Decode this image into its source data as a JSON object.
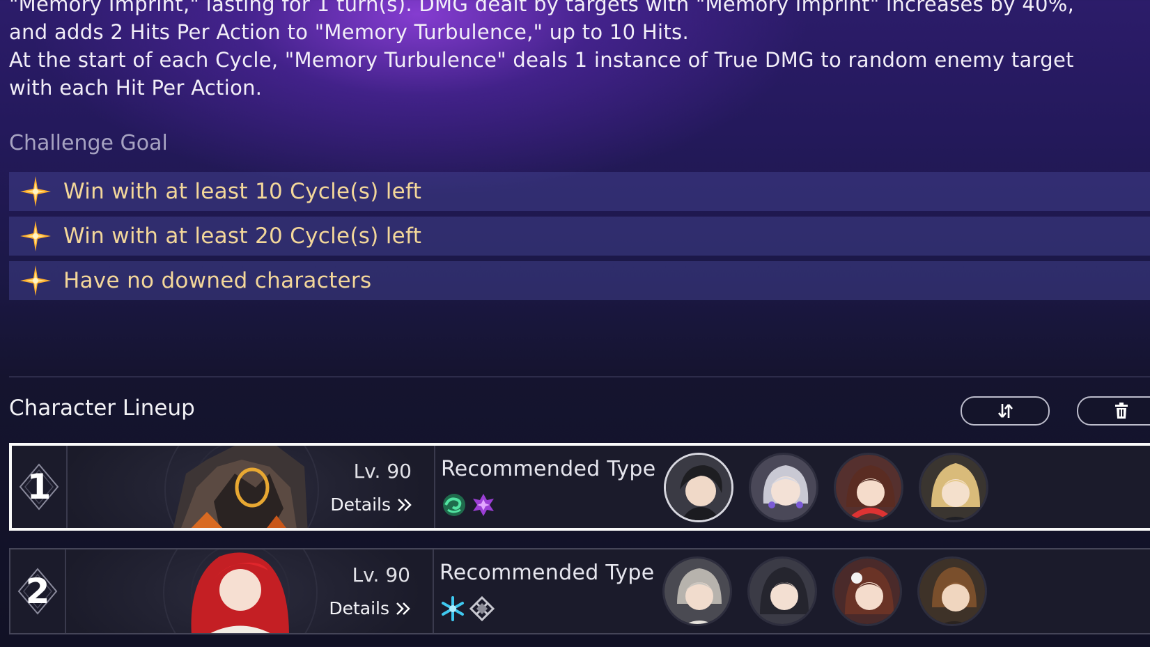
{
  "description": {
    "line1": "\"Memory Imprint,\" lasting for 1 turn(s). DMG dealt by targets with \"Memory Imprint\" increases by 40%,",
    "line2": "and adds 2 Hits Per Action to \"Memory Turbulence,\" up to 10 Hits.",
    "line3": "At the start of each Cycle, \"Memory Turbulence\" deals 1 instance of True DMG to random enemy target",
    "line4": "with each Hit Per Action."
  },
  "challenge_goal": {
    "title": "Challenge Goal",
    "items": [
      {
        "text": "Win with at least 10 Cycle(s) left",
        "icon": "star-burst-icon"
      },
      {
        "text": "Win with at least 20 Cycle(s) left",
        "icon": "star-burst-icon"
      },
      {
        "text": "Have no downed characters",
        "icon": "star-burst-icon"
      }
    ]
  },
  "lineup": {
    "title": "Character Lineup",
    "swap_icon": "swap-icon",
    "delete_icon": "trash-icon",
    "teams": [
      {
        "number": "1",
        "level": "Lv. 90",
        "details_label": "Details",
        "recommended_label": "Recommended Type",
        "types": [
          "wind-element-icon",
          "imaginary-element-icon"
        ],
        "avatars": [
          "avatar-dark-hair-male",
          "avatar-silver-hair-female",
          "avatar-brown-hair-female",
          "avatar-blonde-hair-male"
        ],
        "selected": true
      },
      {
        "number": "2",
        "level": "Lv. 90",
        "details_label": "Details",
        "recommended_label": "Recommended Type",
        "types": [
          "ice-element-icon",
          "physical-element-icon"
        ],
        "avatars": [
          "avatar-grey-hair-male",
          "avatar-black-hair-female",
          "avatar-auburn-hair-female",
          "avatar-brown-hair-male"
        ],
        "selected": false
      }
    ]
  },
  "colors": {
    "goal_text": "#f3d79a",
    "star": "#ffb02e",
    "selected_border": "#fafafa"
  }
}
